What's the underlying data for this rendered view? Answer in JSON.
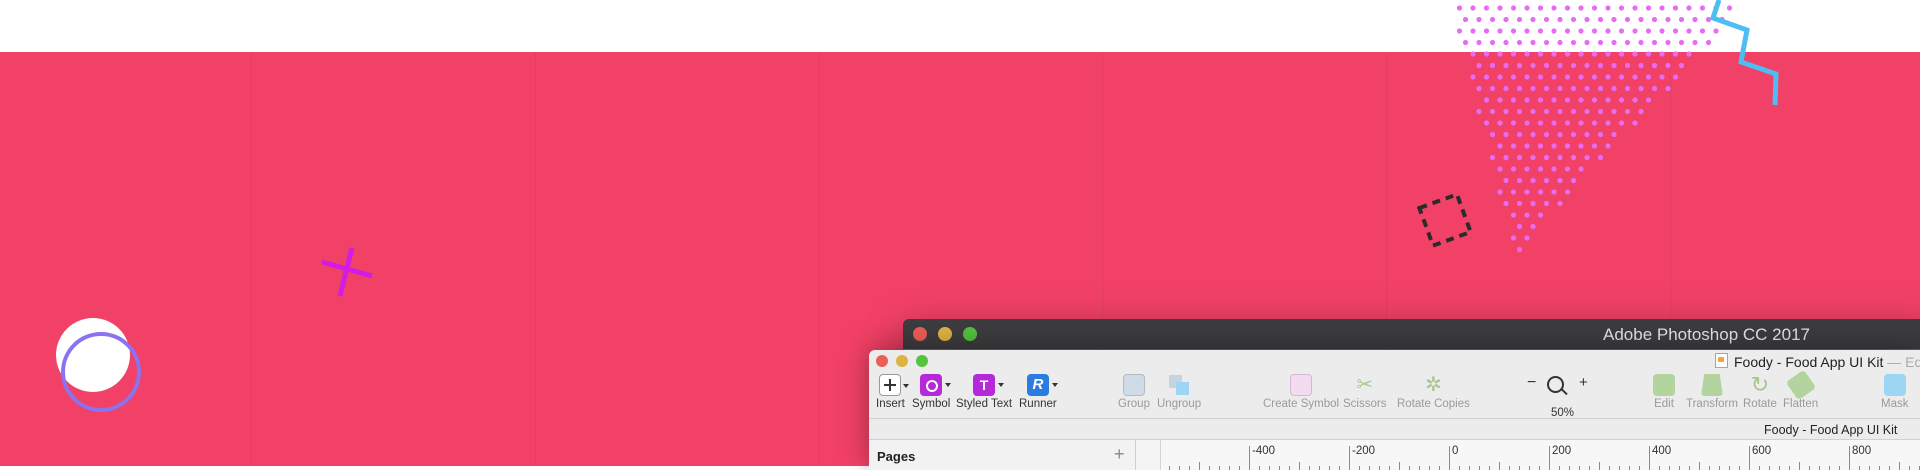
{
  "colors": {
    "hero_background": "#f24166",
    "dots": "#e66df3",
    "cross": "#d21ce3",
    "zigzag": "#4dbef3",
    "ring": "#8a72f0",
    "dashed_square": "#2b2b2b"
  },
  "photoshop_window": {
    "title": "Adobe Photoshop CC 2017"
  },
  "sketch_window": {
    "document_title": "Foody - Food App UI Kit",
    "title_suffix": "— Edited",
    "document_icon": "sketch-document-icon",
    "toolbar": {
      "insert": "Insert",
      "symbol": "Symbol",
      "styled_text": "Styled Text",
      "runner": "Runner",
      "group": "Group",
      "ungroup": "Ungroup",
      "create_symbol": "Create Symbol",
      "scissors": "Scissors",
      "rotate_copies": "Rotate Copies",
      "zoom_minus": "−",
      "zoom_plus": "+",
      "zoom_level": "50%",
      "edit": "Edit",
      "transform": "Transform",
      "rotate": "Rotate",
      "flatten": "Flatten",
      "mask": "Mask"
    },
    "breadcrumb": "Foody - Food App UI Kit",
    "pages_panel": {
      "label": "Pages",
      "add": "+"
    },
    "ruler_labels": [
      "-400",
      "-200",
      "0",
      "200",
      "400",
      "600",
      "800"
    ]
  }
}
